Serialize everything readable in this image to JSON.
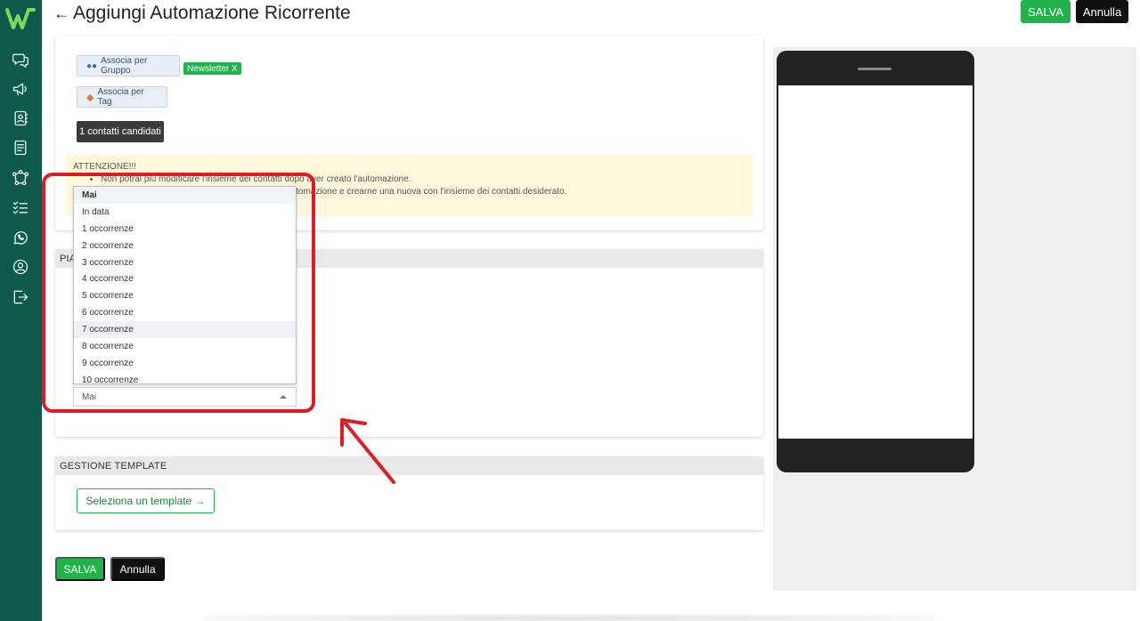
{
  "header": {
    "back_icon": "arrow-left-icon",
    "title": "Aggiungi Automazione Ricorrente",
    "save_label": "SALVA",
    "cancel_label": "Annulla"
  },
  "sidebar": {
    "logo": "w-logo",
    "items": [
      {
        "icon": "chat-icon"
      },
      {
        "icon": "megaphone-icon"
      },
      {
        "icon": "contacts-icon"
      },
      {
        "icon": "document-icon"
      },
      {
        "icon": "flow-icon"
      },
      {
        "icon": "checklist-icon"
      },
      {
        "icon": "whatsapp-icon"
      },
      {
        "icon": "user-icon"
      },
      {
        "icon": "logout-icon"
      }
    ],
    "bg_color": "#0d5a4a"
  },
  "contacts": {
    "group_button": "Associa per Gruppo",
    "group_badge": "Newsletter X",
    "tag_button": "Associa per Tag",
    "candidates": "1 contatti candidati"
  },
  "warning": {
    "title": "ATTENZIONE!!!",
    "line1": "Non potrai più modificare l'insieme dei contatti dopo aver creato l'automazione.",
    "line2": "automazione e crearne una nuova con l'insieme dei contatti desiderato."
  },
  "plan_section": {
    "header": "PIA"
  },
  "dropdown": {
    "options": [
      "Mai",
      "In data",
      "1 occorrenze",
      "2 occorrenze",
      "3 occorrenze",
      "4 occorrenze",
      "5 occorrenze",
      "6 occorrenze",
      "7 occorrenze",
      "8 occorrenze",
      "9 occorrenze",
      "10 occorrenze"
    ],
    "selected_value": "Mai"
  },
  "template_section": {
    "header": "GESTIONE TEMPLATE",
    "select_label": "Seleziona un template →"
  },
  "footer": {
    "save_label": "SALVA",
    "cancel_label": "Annulla"
  },
  "colors": {
    "accent_green": "#22b24c",
    "annotation_red": "#e01b22",
    "warning_bg": "#fff8dc"
  }
}
